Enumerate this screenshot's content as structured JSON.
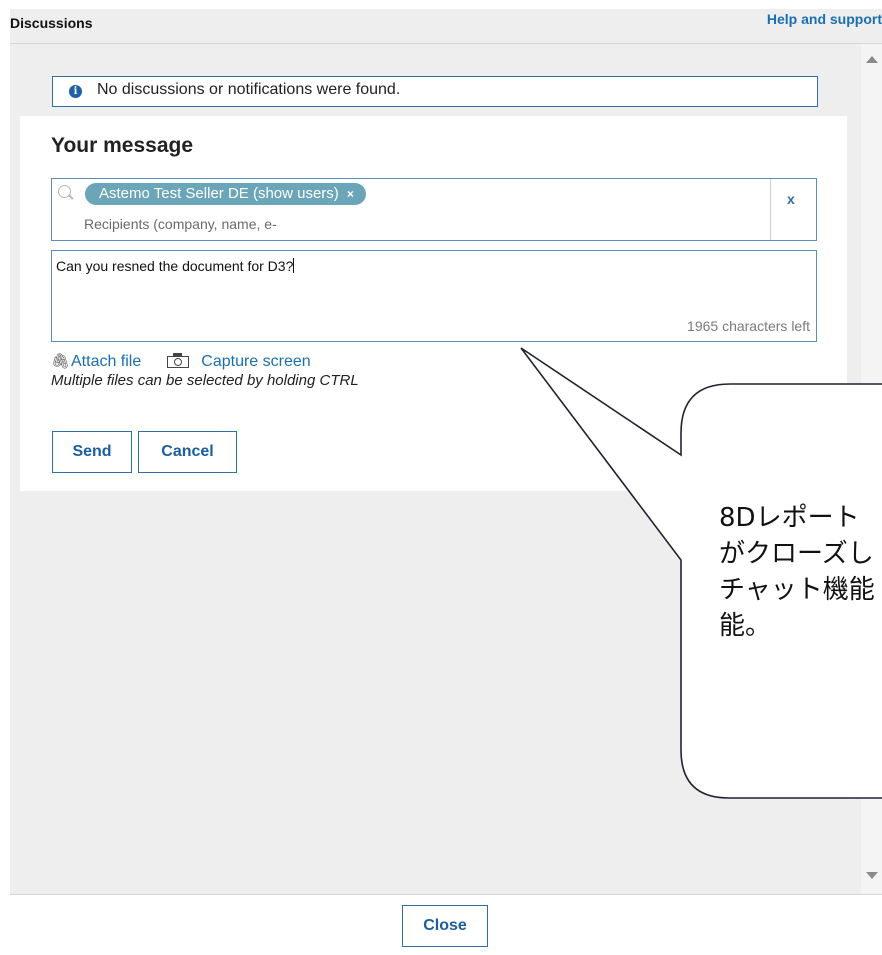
{
  "header": {
    "title": "Discussions",
    "help_link": "Help and support"
  },
  "notice": {
    "icon": "info-icon",
    "text": "No discussions or notifications were found."
  },
  "composer": {
    "title": "Your message",
    "recipients": {
      "chip_label": "Astemo Test Seller DE (show users)",
      "chip_remove": "×",
      "placeholder": "Recipients (company, name, e-",
      "clear_label": "x"
    },
    "message": {
      "text": "Can you resned the document for D3?",
      "chars_left": "1965 characters left"
    },
    "attach_label": "Attach file",
    "capture_label": "Capture screen",
    "hint": "Multiple files can be selected by holding CTRL",
    "send_label": "Send",
    "cancel_label": "Cancel"
  },
  "callout": {
    "lines": [
      "8Dレポート",
      "がクローズし",
      "チャット機能",
      "能。"
    ]
  },
  "footer": {
    "close_label": "Close"
  },
  "colors": {
    "link": "#1a6fb0",
    "chip": "#6aa5b8",
    "border": "#2f6fa6",
    "panel_bg": "#eeeeee"
  }
}
